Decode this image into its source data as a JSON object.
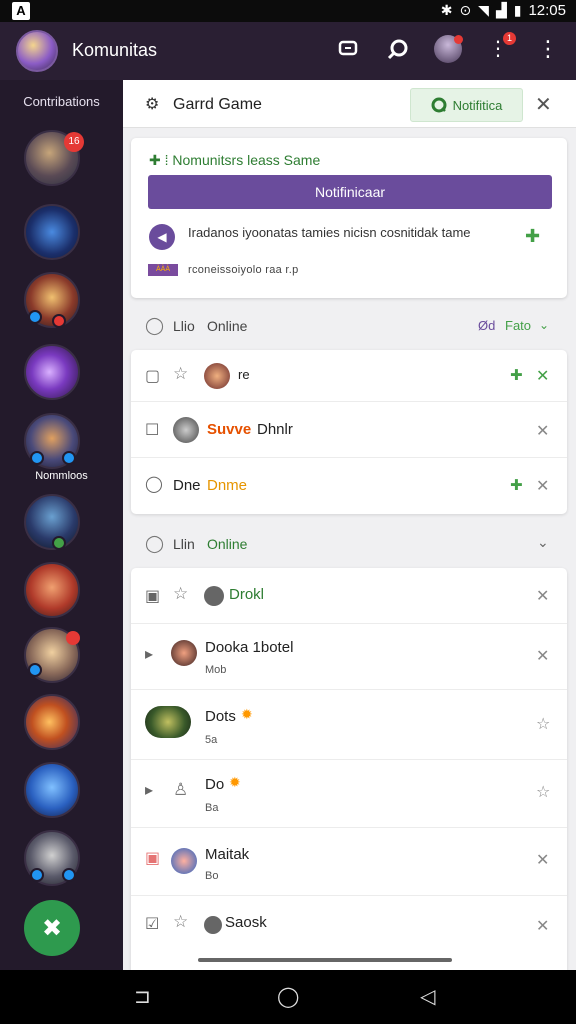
{
  "status_bar": {
    "time": "12:05",
    "left_icon": "A"
  },
  "app_bar": {
    "title": "Komunitas",
    "notif_count": "1"
  },
  "sidebar": {
    "heading": "Contribations",
    "server_label": "Nommloos",
    "first_badge": "16"
  },
  "panel": {
    "title": "Garrd Game",
    "notification_button": "Notifitica"
  },
  "card": {
    "header": "Nomunitsrs leass Same",
    "button": "Notifinicaar",
    "message": "Iradanos iyoonatas tamies nicisn cosnitidak tame",
    "sub_icon_text": "ÀÀÀ",
    "sub": "rconeissoiyolo raa r.p"
  },
  "section1": {
    "label1": "Llio",
    "label2": "Online",
    "right1": "Ød",
    "right2": "Fato"
  },
  "section2": {
    "label1": "Llin",
    "label2": "Online"
  },
  "list1": [
    {
      "name": "re",
      "name_color": "#222"
    },
    {
      "name": "Suvve",
      "name2": "Dhnlr",
      "name_color": "#e65100"
    },
    {
      "prefix": "Dne",
      "name": "Dnme",
      "name_color": "#e69500"
    }
  ],
  "list2": [
    {
      "name": "Drokl",
      "name_color": "#2e7d32",
      "sub": ""
    },
    {
      "name": "Dooka  1botel",
      "name_color": "#222",
      "sub": "Mob"
    },
    {
      "name": "Dots",
      "name_color": "#222",
      "sub": "5a"
    },
    {
      "name": "Do",
      "name_color": "#222",
      "sub": "Ba"
    },
    {
      "name": "Maitak",
      "name_color": "#222",
      "sub": "Bo"
    },
    {
      "name": "Saosk",
      "name_color": "#222",
      "sub": ""
    }
  ]
}
